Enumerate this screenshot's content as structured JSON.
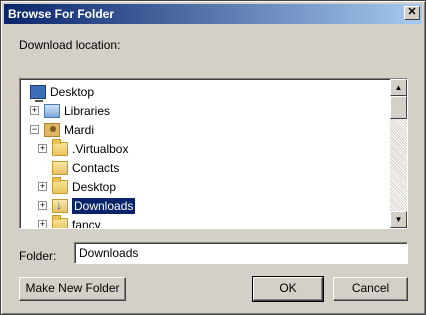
{
  "window": {
    "title": "Browse For Folder",
    "close_label": "✕"
  },
  "header": {
    "download_location_label": "Download location:"
  },
  "tree": {
    "items": [
      {
        "label": "Desktop",
        "expander": "",
        "icon": "desktop-icon"
      },
      {
        "label": "Libraries",
        "expander": "+",
        "icon": "libraries-icon"
      },
      {
        "label": "Mardi",
        "expander": "−",
        "icon": "user-folder-icon"
      },
      {
        "label": ".Virtualbox",
        "expander": "+",
        "icon": "folder-icon"
      },
      {
        "label": "Contacts",
        "expander": "",
        "icon": "contacts-icon"
      },
      {
        "label": "Desktop",
        "expander": "+",
        "icon": "folder-icon"
      },
      {
        "label": "Downloads",
        "expander": "+",
        "icon": "downloads-icon",
        "selected": true
      },
      {
        "label": "fancy",
        "expander": "+",
        "icon": "folder-icon"
      }
    ],
    "scroll_up": "▲",
    "scroll_down": "▼"
  },
  "folder_field": {
    "label": "Folder:",
    "value": "Downloads"
  },
  "buttons": {
    "make_new_folder": "Make New Folder",
    "ok": "OK",
    "cancel": "Cancel"
  }
}
